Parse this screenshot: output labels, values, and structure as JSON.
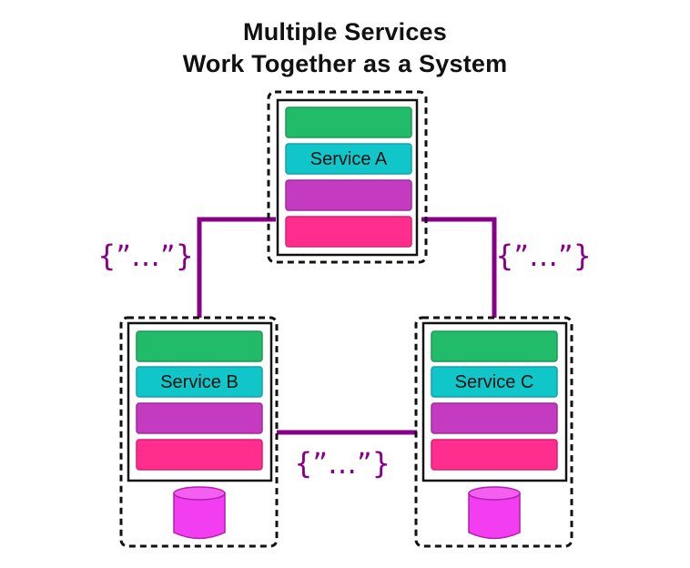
{
  "title": {
    "line1": "Multiple Services",
    "line2": "Work Together  as a System"
  },
  "colors": {
    "layer_green": "#22bb6a",
    "layer_teal": "#11c6c9",
    "layer_purple": "#c43ac1",
    "layer_pink": "#ff2e8e",
    "connector": "#880088",
    "database": "#f23ef0"
  },
  "services": [
    {
      "id": "a",
      "label": "Service A",
      "has_database": false
    },
    {
      "id": "b",
      "label": "Service B",
      "has_database": true
    },
    {
      "id": "c",
      "label": "Service C",
      "has_database": true
    }
  ],
  "connections": [
    {
      "from": "Service A",
      "to": "Service B",
      "payload_label": "{\"...\"}"
    },
    {
      "from": "Service A",
      "to": "Service C",
      "payload_label": "{\"...\"}"
    },
    {
      "from": "Service B",
      "to": "Service C",
      "payload_label": "{\"...\"}"
    }
  ],
  "payload_display": "{”…”}"
}
